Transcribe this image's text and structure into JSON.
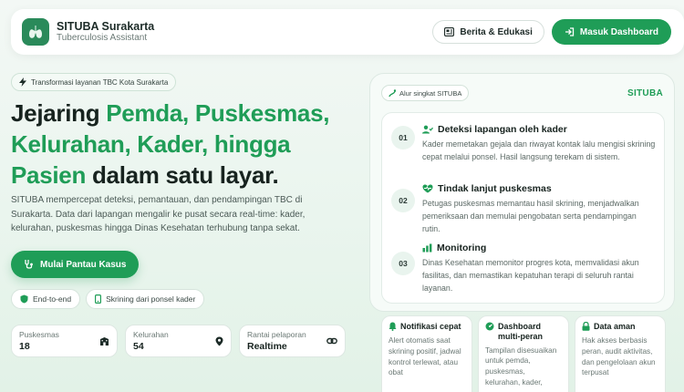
{
  "header": {
    "brand_title": "SITUBA Surakarta",
    "brand_subtitle": "Tuberculosis Assistant",
    "news_label": "Berita & Edukasi",
    "dashboard_label": "Masuk Dashboard"
  },
  "hero": {
    "pill": "Transformasi layanan TBC Kota Surakarta",
    "headline": {
      "part1": "Jejaring ",
      "highlight1": "Pemda, Puskesmas, Kelurahan, Kader, hingga Pasien",
      "part2": " dalam satu layar."
    },
    "description": "SITUBA mempercepat deteksi, pemantauan, dan pendampingan TBC di Surakarta. Data dari lapangan mengalir ke pusat secara real-time: kader, kelurahan, puskesmas hingga Dinas Kesehatan terhubung tanpa sekat.",
    "cta_label": "Mulai Pantau Kasus",
    "tags": [
      "End-to-end",
      "Skrining dari ponsel kader"
    ],
    "stats": [
      {
        "label": "Puskesmas",
        "value": "18"
      },
      {
        "label": "Kelurahan",
        "value": "54"
      },
      {
        "label": "Rantai pelaporan",
        "value": "Realtime"
      }
    ]
  },
  "panel": {
    "pill": "Alur singkat SITUBA",
    "brand": "SITUBA",
    "steps": [
      {
        "num": "01",
        "title": "Deteksi lapangan oleh kader",
        "text": "Kader memetakan gejala dan riwayat kontak lalu mengisi skrining cepat melalui ponsel. Hasil langsung terekam di sistem."
      },
      {
        "num": "02",
        "title": "Tindak lanjut puskesmas",
        "text": "Petugas puskesmas memantau hasil skrining, menjadwalkan pemeriksaan dan memulai pengobatan serta pendampingan rutin."
      },
      {
        "num": "03",
        "title": "Monitoring",
        "text": "Dinas Kesehatan memonitor progres kota, memvalidasi akun fasilitas, dan memastikan kepatuhan terapi di seluruh rantai layanan."
      }
    ]
  },
  "cards": [
    {
      "title": "Notifikasi cepat",
      "text": "Alert otomatis saat skrining positif, jadwal kontrol terlewat, atau obat"
    },
    {
      "title": "Dashboard multi-peran",
      "text": "Tampilan disesuaikan untuk pemda, puskesmas, kelurahan, kader,"
    },
    {
      "title": "Data aman",
      "text": "Hak akses berbasis peran, audit aktivitas, dan pengelolaan akun terpusat"
    }
  ],
  "colors": {
    "accent": "#1f9d57",
    "background": "#eaf5ee"
  },
  "icons": [
    "lungs-icon",
    "newspaper-icon",
    "login-icon",
    "bolt-icon",
    "stethoscope-icon",
    "shield-icon",
    "phone-icon",
    "building-icon",
    "map-pin-icon",
    "link-icon",
    "route-icon",
    "user-check-icon",
    "heart-pulse-icon",
    "chart-icon",
    "bell-icon",
    "dashboard-icon",
    "lock-icon"
  ]
}
